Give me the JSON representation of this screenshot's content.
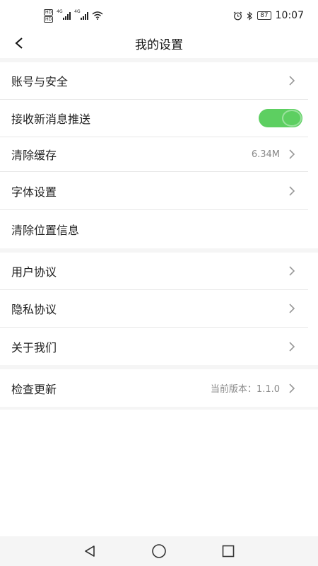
{
  "status_bar": {
    "hd1": "HD",
    "hd2": "HD",
    "net1": "4G",
    "net2": "4G",
    "battery": "87",
    "time": "10:07"
  },
  "header": {
    "title": "我的设置"
  },
  "groups": [
    {
      "items": [
        {
          "label": "账号与安全",
          "value": "",
          "chevron": true
        },
        {
          "label": "接收新消息推送",
          "toggle": true,
          "toggle_on": true
        },
        {
          "label": "清除缓存",
          "value": "6.34M",
          "chevron": true
        },
        {
          "label": "字体设置",
          "value": "",
          "chevron": true
        },
        {
          "label": "清除位置信息",
          "value": "",
          "chevron": false
        }
      ]
    },
    {
      "items": [
        {
          "label": "用户协议",
          "chevron": true
        },
        {
          "label": "隐私协议",
          "chevron": true
        },
        {
          "label": "关于我们",
          "chevron": true
        }
      ]
    },
    {
      "items": [
        {
          "label": "检查更新",
          "value": "当前版本：1.1.0",
          "chevron": true
        }
      ]
    }
  ],
  "colors": {
    "toggle_on": "#5dcf61",
    "background": "#f5f5f5"
  }
}
